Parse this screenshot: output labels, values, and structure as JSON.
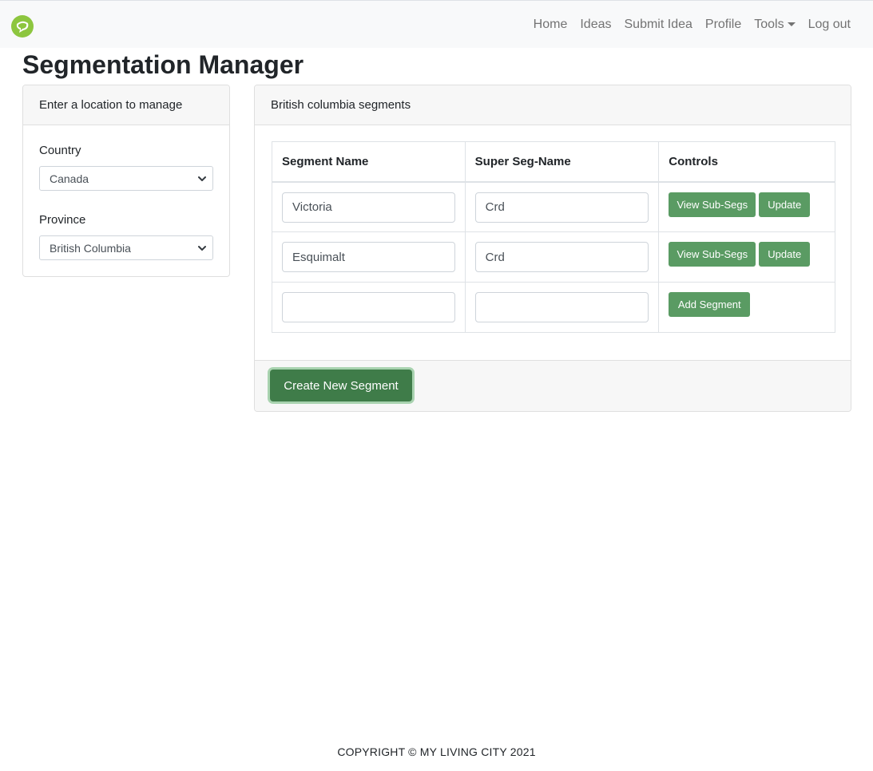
{
  "nav": {
    "logo_icon": "leaf-chat-icon",
    "links": [
      "Home",
      "Ideas",
      "Submit Idea",
      "Profile",
      "Tools",
      "Log out"
    ]
  },
  "page": {
    "title": "Segmentation Manager"
  },
  "location_card": {
    "header": "Enter a location to manage",
    "country_label": "Country",
    "country_value": "Canada",
    "province_label": "Province",
    "province_value": "British Columbia"
  },
  "segments_card": {
    "header": "British columbia segments",
    "columns": [
      "Segment Name",
      "Super Seg-Name",
      "Controls"
    ],
    "rows": [
      {
        "segment_name": "Victoria",
        "super_seg_name": "Crd",
        "view_label": "View Sub-Segs",
        "update_label": "Update"
      },
      {
        "segment_name": "Esquimalt",
        "super_seg_name": "Crd",
        "view_label": "View Sub-Segs",
        "update_label": "Update"
      }
    ],
    "new_row": {
      "segment_name": "",
      "super_seg_name": "",
      "add_label": "Add Segment"
    },
    "create_button": "Create New Segment"
  },
  "footer": {
    "text": "COPYRIGHT © MY LIVING CITY 2021"
  },
  "colors": {
    "primary_green": "#5a9b63",
    "dark_green": "#3f7c49",
    "navbar_bg": "#f8f9fa"
  }
}
